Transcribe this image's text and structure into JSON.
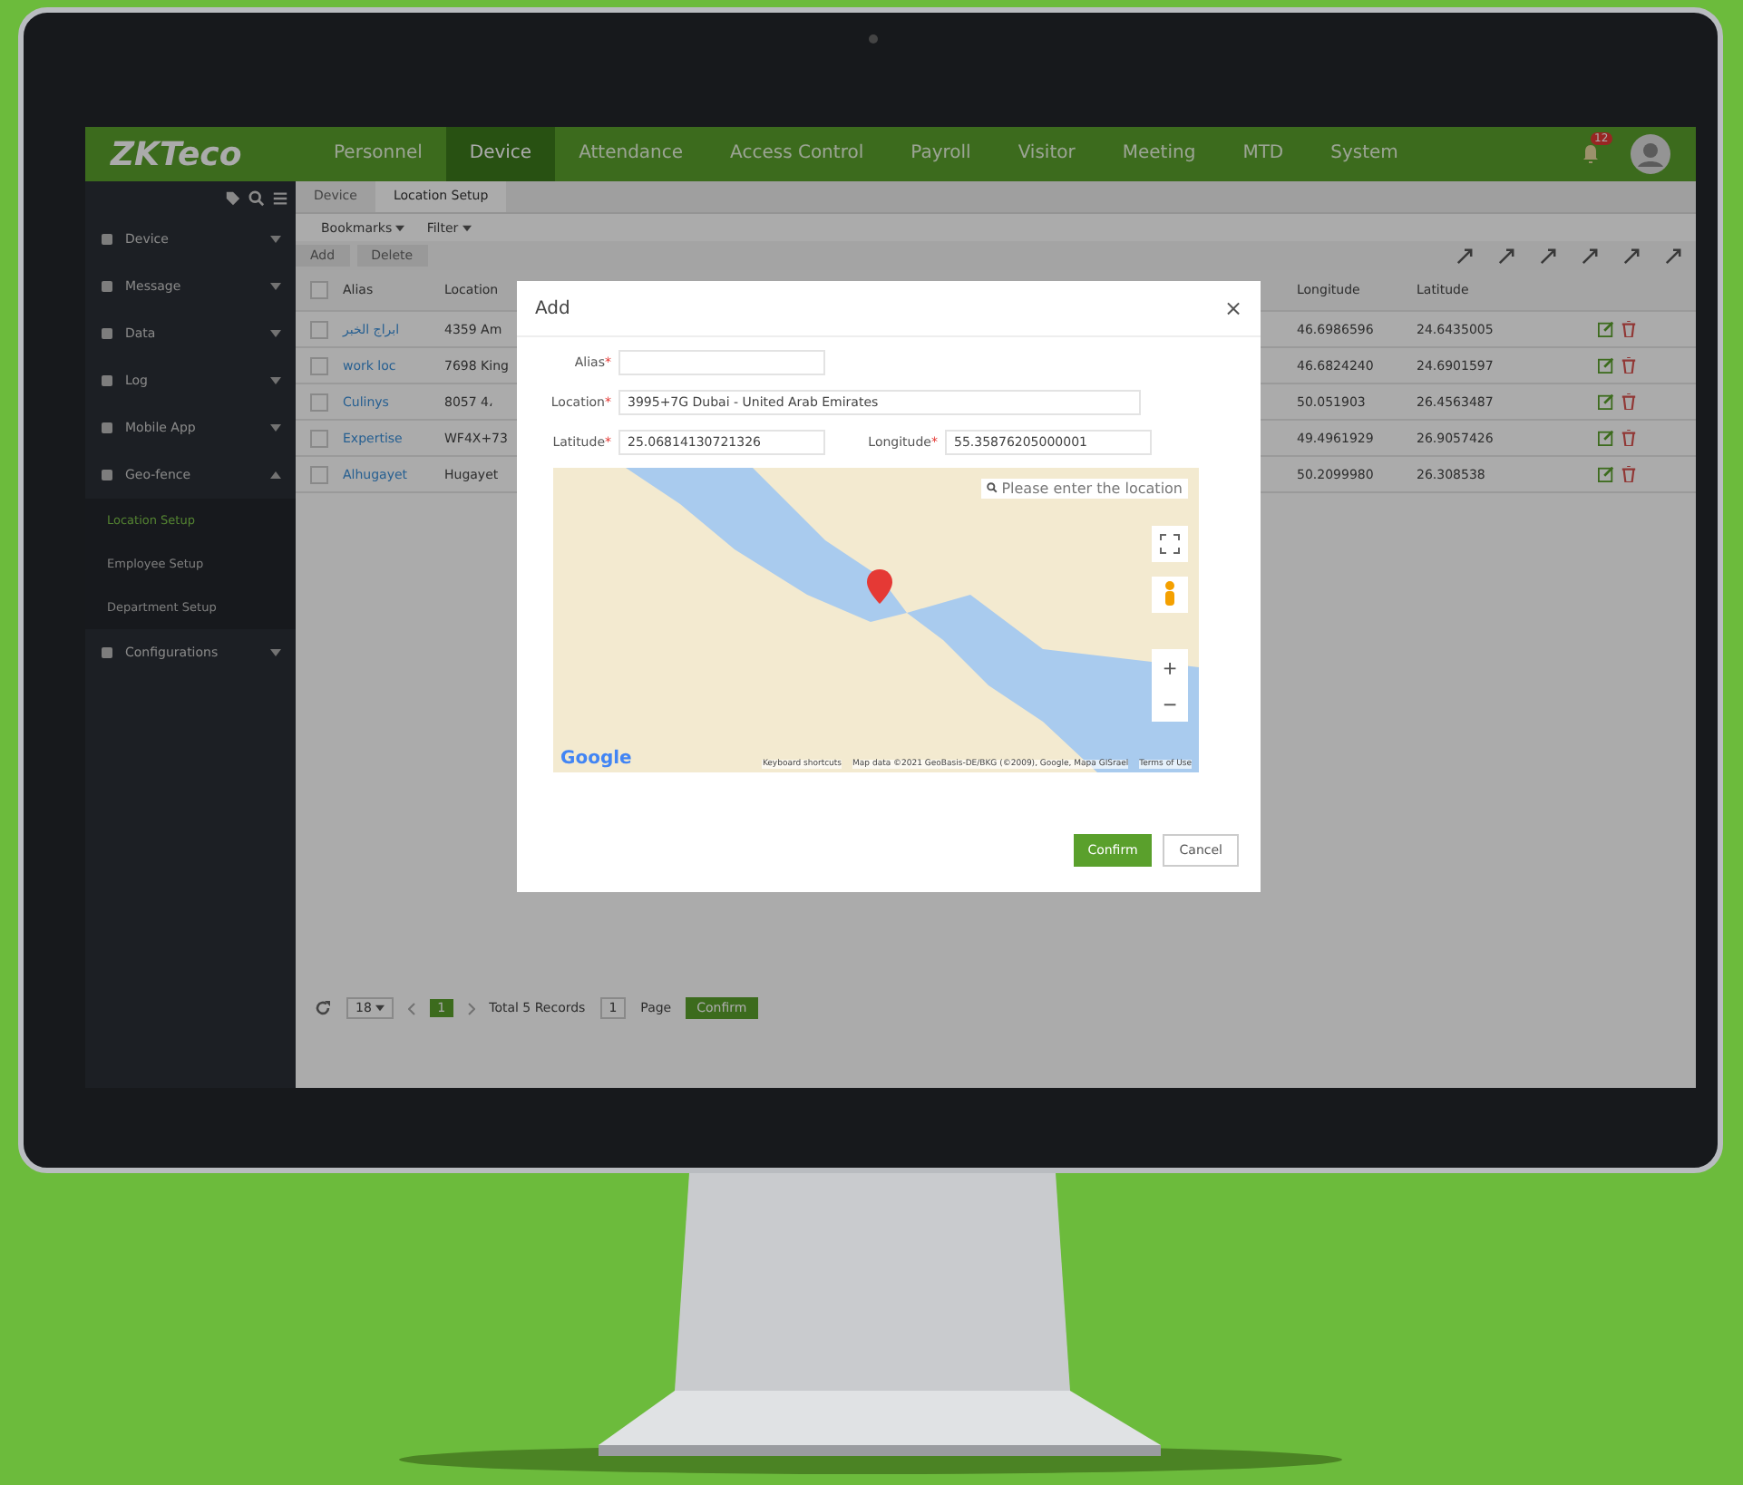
{
  "header": {
    "logo": "ZKTeco",
    "nav": [
      {
        "label": "Personnel",
        "selected": false
      },
      {
        "label": "Device",
        "selected": true
      },
      {
        "label": "Attendance",
        "selected": false
      },
      {
        "label": "Access Control",
        "selected": false
      },
      {
        "label": "Payroll",
        "selected": false
      },
      {
        "label": "Visitor",
        "selected": false
      },
      {
        "label": "Meeting",
        "selected": false
      },
      {
        "label": "MTD",
        "selected": false
      },
      {
        "label": "System",
        "selected": false
      }
    ],
    "notification_badge": "12"
  },
  "sidebar": {
    "items": [
      {
        "label": "Device",
        "expanded": false
      },
      {
        "label": "Message",
        "expanded": false
      },
      {
        "label": "Data",
        "expanded": false
      },
      {
        "label": "Log",
        "expanded": false
      },
      {
        "label": "Mobile App",
        "expanded": false
      },
      {
        "label": "Geo-fence",
        "expanded": true,
        "children": [
          {
            "label": "Location Setup",
            "selected": true
          },
          {
            "label": "Employee Setup",
            "selected": false
          },
          {
            "label": "Department Setup",
            "selected": false
          }
        ]
      },
      {
        "label": "Configurations",
        "expanded": false
      }
    ]
  },
  "tabs": [
    {
      "label": "Device",
      "selected": false
    },
    {
      "label": "Location Setup",
      "selected": true
    }
  ],
  "toolbar": [
    "Bookmarks",
    "Filter"
  ],
  "actions": [
    "Add",
    "Delete"
  ],
  "table": {
    "columns": [
      "Alias",
      "Location",
      "Longitude",
      "Latitude"
    ],
    "select_all_checked": false,
    "rows": [
      {
        "checked": false,
        "alias": "ابراج الخبر",
        "location": "4359 Am",
        "longitude": "46.6986596",
        "latitude": "24.6435005"
      },
      {
        "checked": false,
        "alias": "work loc",
        "location": "7698 King",
        "longitude": "46.6824240",
        "latitude": "24.6901597"
      },
      {
        "checked": false,
        "alias": "Culinys",
        "location": "8057 4،",
        "longitude": "50.051903",
        "latitude": "26.4563487"
      },
      {
        "checked": false,
        "alias": "Expertise",
        "location": "WF4X+73",
        "longitude": "49.4961929",
        "latitude": "26.9057426"
      },
      {
        "checked": false,
        "alias": "Alhugayet",
        "location": "Hugayet",
        "longitude": "50.2099980",
        "latitude": "26.308538"
      }
    ]
  },
  "pager": {
    "page_size": "18",
    "current_page": "1",
    "total": "Total 5 Records",
    "page_input": "1",
    "page_label": "Page",
    "confirm": "Confirm"
  },
  "dialog": {
    "title": "Add",
    "close": "×",
    "alias": {
      "label": "Alias",
      "required_mark": "*"
    },
    "location": {
      "label": "Location",
      "required_mark": "*",
      "value": "3995+7G Dubai - United Arab Emirates"
    },
    "latitude": {
      "label": "Latitude",
      "required_mark": "*",
      "value": "25.06814130721326"
    },
    "longitude": {
      "label": "Longitude",
      "required_mark": "*",
      "value": "55.35876205000001"
    },
    "map": {
      "search_placeholder": "Please enter the location",
      "zoom_in": "+",
      "zoom_out": "−",
      "brand": "Google",
      "footer": [
        "Keyboard shortcuts",
        "Map data ©2021 GeoBasis-DE/BKG (©2009), Google, Mapa GISrael",
        "Terms of Use"
      ]
    },
    "buttons": [
      {
        "label": "Confirm",
        "kind": "primary"
      },
      {
        "label": "Cancel",
        "kind": "secondary"
      }
    ]
  }
}
